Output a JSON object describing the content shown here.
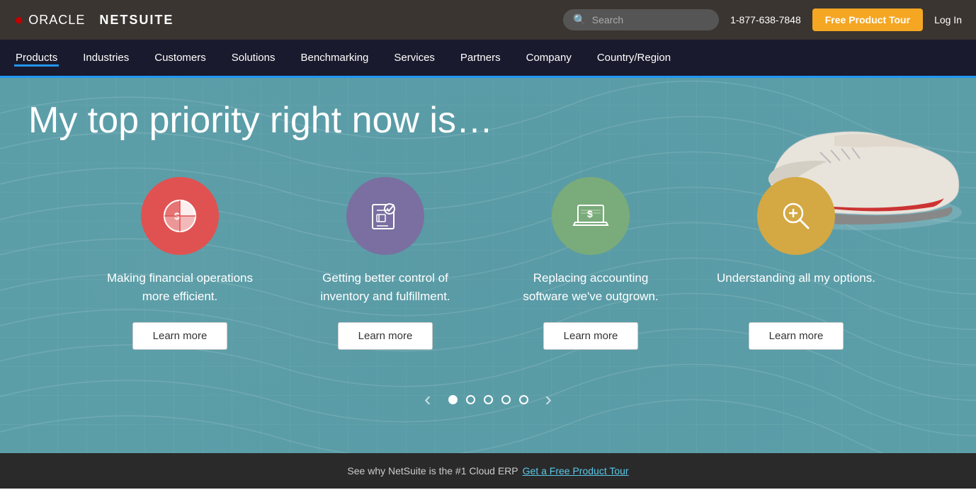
{
  "topbar": {
    "logo_oracle": "ORACLE",
    "logo_netsuite": "NETSUITE",
    "phone": "1-877-638-7848",
    "tour_button": "Free Product Tour",
    "login": "Log In",
    "search_placeholder": "Search"
  },
  "nav": {
    "items": [
      {
        "label": "Products",
        "active": true
      },
      {
        "label": "Industries",
        "active": false
      },
      {
        "label": "Customers",
        "active": false
      },
      {
        "label": "Solutions",
        "active": false
      },
      {
        "label": "Benchmarking",
        "active": false
      },
      {
        "label": "Services",
        "active": false
      },
      {
        "label": "Partners",
        "active": false
      },
      {
        "label": "Company",
        "active": false
      },
      {
        "label": "Country/Region",
        "active": false
      }
    ]
  },
  "hero": {
    "title": "My top priority right now is…",
    "cards": [
      {
        "id": "financial",
        "color": "red",
        "text": "Making financial operations more efficient.",
        "button": "Learn more"
      },
      {
        "id": "inventory",
        "color": "purple",
        "text": "Getting better control of inventory and fulfillment.",
        "button": "Learn more"
      },
      {
        "id": "accounting",
        "color": "green",
        "text": "Replacing accounting software we've outgrown.",
        "button": "Learn more"
      },
      {
        "id": "options",
        "color": "gold",
        "text": "Understanding all my options.",
        "button": "Learn more"
      }
    ],
    "carousel_dots": 5,
    "carousel_active": 0
  },
  "bottom_bar": {
    "text": "See why NetSuite is the #1 Cloud ERP",
    "link": "Get a Free Product Tour"
  }
}
